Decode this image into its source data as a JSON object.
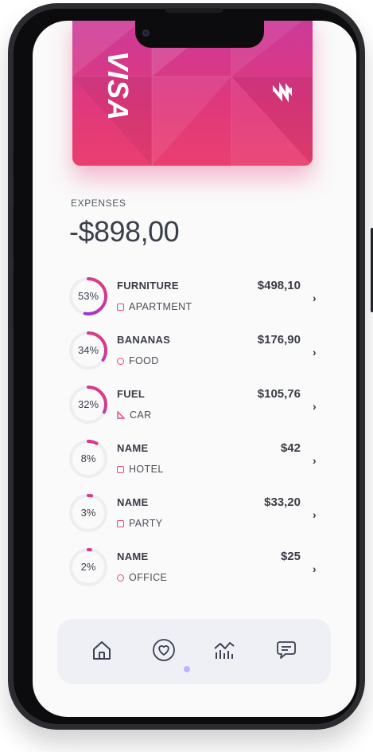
{
  "card": {
    "brand": "VISA",
    "logo_icon": "zigzag-logo-icon",
    "colors": {
      "top": "#c93a9b",
      "bottom": "#ea3f6f"
    }
  },
  "expenses": {
    "label": "EXPENSES",
    "total": "-$898,00"
  },
  "items": [
    {
      "title": "FURNITURE",
      "category": "APARTMENT",
      "category_icon": "square-icon",
      "amount": "$498,10",
      "percent_label": "53%",
      "percent": 53
    },
    {
      "title": "BANANAS",
      "category": "FOOD",
      "category_icon": "circle-icon",
      "amount": "$176,90",
      "percent_label": "34%",
      "percent": 34
    },
    {
      "title": "FUEL",
      "category": "CAR",
      "category_icon": "triangle-ruler-icon",
      "amount": "$105,76",
      "percent_label": "32%",
      "percent": 32
    },
    {
      "title": "NAME",
      "category": "HOTEL",
      "category_icon": "square-icon",
      "amount": "$42",
      "percent_label": "8%",
      "percent": 8
    },
    {
      "title": "NAME",
      "category": "PARTY",
      "category_icon": "square-icon",
      "amount": "$33,20",
      "percent_label": "3%",
      "percent": 3
    },
    {
      "title": "NAME",
      "category": "OFFICE",
      "category_icon": "circle-icon",
      "amount": "$25",
      "percent_label": "2%",
      "percent": 2
    }
  ],
  "tabbar": {
    "tabs": [
      "home-icon",
      "heart-icon",
      "analytics-icon",
      "chat-icon"
    ],
    "active_index": 1
  },
  "colors": {
    "ring_start": "#7a3cf0",
    "ring_end": "#ee3a72",
    "ring_track": "#eeeef2",
    "active_dot": "#b9b4ff"
  }
}
